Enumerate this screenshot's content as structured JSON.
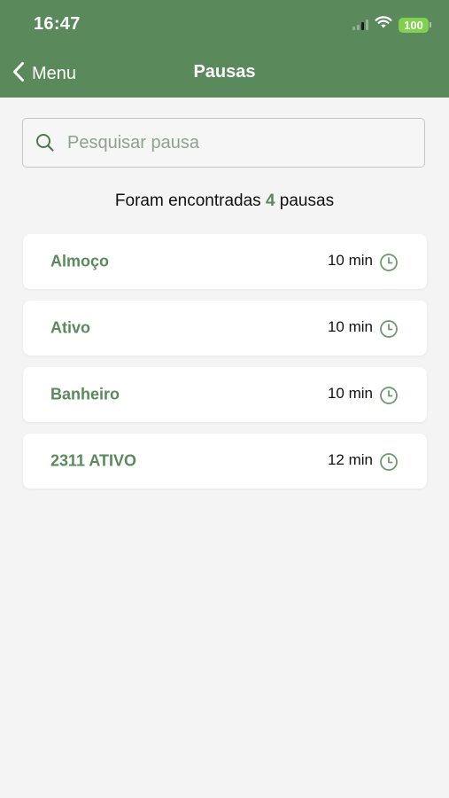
{
  "status_bar": {
    "time": "16:47",
    "battery_level": "100",
    "icons": [
      "signal-icon",
      "wifi-icon",
      "battery-icon"
    ]
  },
  "nav": {
    "back_label": "Menu",
    "title": "Pausas"
  },
  "search": {
    "placeholder": "Pesquisar pausa",
    "value": ""
  },
  "results": {
    "prefix": "Foram encontradas",
    "count": "4",
    "suffix": "pausas"
  },
  "pauses": [
    {
      "name": "Almoço",
      "duration": "10 min"
    },
    {
      "name": "Ativo",
      "duration": "10 min"
    },
    {
      "name": "Banheiro",
      "duration": "10 min"
    },
    {
      "name": "2311 ATIVO",
      "duration": "12 min"
    }
  ],
  "colors": {
    "primary": "#5a8a5b",
    "background": "#f4f4f4",
    "card": "#ffffff",
    "battery": "#7fd14e"
  }
}
